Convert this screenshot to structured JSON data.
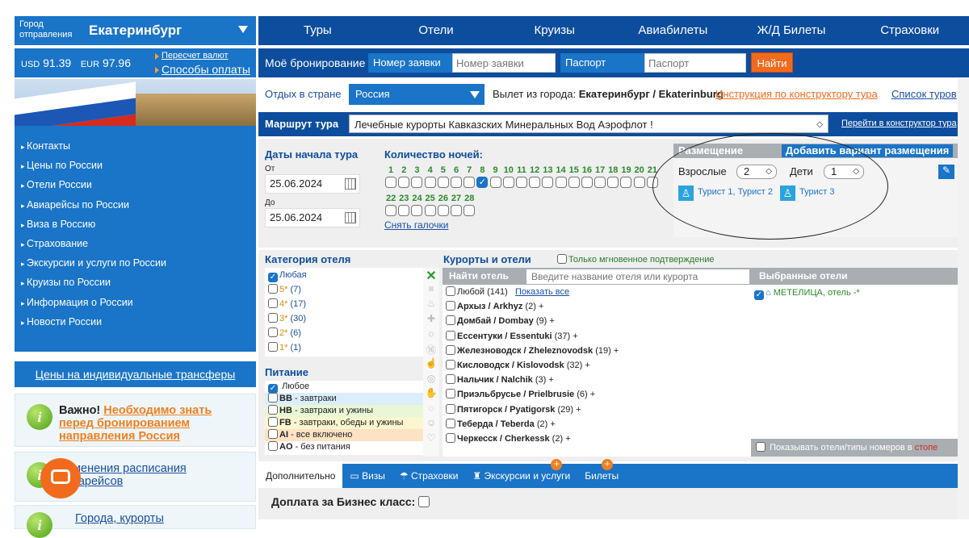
{
  "city": {
    "label_line1": "Город",
    "label_line2": "отправления",
    "name": "Екатеринбург"
  },
  "top_nav": [
    "Туры",
    "Отели",
    "Круизы",
    "Авиабилеты",
    "Ж/Д Билеты",
    "Страховки"
  ],
  "currency": {
    "usd_label": "USD",
    "usd_value": "91.39",
    "eur_label": "EUR",
    "eur_value": "97.96",
    "recalc_link": "Пересчет валют",
    "payment_link": "Способы оплаты"
  },
  "booking": {
    "title": "Моё бронирование",
    "order_label": "Номер заявки",
    "order_placeholder": "Номер заявки",
    "passport_label": "Паспорт",
    "passport_placeholder": "Паспорт",
    "find_button": "Найти"
  },
  "left_menu": [
    "Контакты",
    "Цены по России",
    "Отели России",
    "Авиарейсы по России",
    "Виза в Россию",
    "Страхование",
    "Экскурсии и услуги по России",
    "Круизы по России",
    "Информация о России",
    "Новости России"
  ],
  "transfer_link": "Цены на индивидуальные трансферы",
  "info1": {
    "icon": "i",
    "bold": "Важно!",
    "link": "Необходимо знать перед бронированием направления Россия"
  },
  "info2": {
    "icon": "i",
    "link": "Изменения расписания авиарейсов"
  },
  "info3": {
    "icon": "i",
    "link": "Города, курорты"
  },
  "country_row": {
    "label": "Отдых в стране",
    "country": "Россия",
    "departure_prefix": "Вылет из города:",
    "departure_city": "Екатеринбург / Ekaterinburg",
    "instruction_link": "Инструкция по конструктору тура",
    "tours_link": "Список туров"
  },
  "route": {
    "label": "Маршрут тура",
    "value": "Лечебные курорты Кавказских Минеральных Вод Аэрофлот   !",
    "link": "Перейти в конструктор тура"
  },
  "dates": {
    "title": "Даты начала тура",
    "from_label": "От",
    "from_value": "25.06.2024",
    "to_label": "До",
    "to_value": "25.06.2024"
  },
  "nights": {
    "title": "Количество ночей:",
    "row1": [
      "1",
      "2",
      "3",
      "4",
      "5",
      "6",
      "7",
      "8",
      "9",
      "10",
      "11",
      "12",
      "13",
      "14",
      "15",
      "16",
      "17",
      "18",
      "19",
      "20",
      "21"
    ],
    "row2": [
      "22",
      "23",
      "24",
      "25",
      "26",
      "27",
      "28"
    ],
    "checked": "8",
    "clear_link": "Снять галочки"
  },
  "placement": {
    "title": "Размещение",
    "add_button": "Добавить вариант размещения",
    "adults_label": "Взрослые",
    "adults_value": "2",
    "children_label": "Дети",
    "children_value": "1",
    "tourists_a": "Турист 1, Турист 2",
    "tourists_b": "Турист 3"
  },
  "hotel_category": {
    "title": "Категория отеля",
    "items": [
      {
        "label": "Любая",
        "star": "",
        "count": "",
        "checked": true
      },
      {
        "label": "",
        "star": "5*",
        "count": "(7)",
        "checked": false
      },
      {
        "label": "",
        "star": "4*",
        "count": "(17)",
        "checked": false
      },
      {
        "label": "",
        "star": "3*",
        "count": "(30)",
        "checked": false
      },
      {
        "label": "",
        "star": "2*",
        "count": "(6)",
        "checked": false
      },
      {
        "label": "",
        "star": "1*",
        "count": "(1)",
        "checked": false
      }
    ]
  },
  "meals": {
    "title": "Питание",
    "items": [
      {
        "code": "",
        "text": "Любое",
        "color": "#ffffff",
        "checked": true
      },
      {
        "code": "BB",
        "text": "- завтраки",
        "color": "#dbeefb",
        "checked": false
      },
      {
        "code": "HB",
        "text": "- завтраки и ужины",
        "color": "#e9f7d6",
        "checked": false
      },
      {
        "code": "FB",
        "text": "- завтраки, обеды и ужины",
        "color": "#fbf6cf",
        "checked": false
      },
      {
        "code": "AI",
        "text": "- все включено",
        "color": "#fde2c4",
        "checked": false
      },
      {
        "code": "AO",
        "text": "- без питания",
        "color": "#ffffff",
        "checked": false
      }
    ]
  },
  "resorts": {
    "title": "Курорты и отели",
    "instant_label": "Только мгновенное подтверждение",
    "find_label": "Найти отель",
    "search_placeholder": "Введите название отеля или курорта",
    "any_label": "Любой",
    "any_count": "(141)",
    "show_all": "Показать все",
    "items": [
      {
        "name": "Архыз / Arkhyz",
        "count": "(2)"
      },
      {
        "name": "Домбай / Dombay",
        "count": "(9)"
      },
      {
        "name": "Ессентуки / Essentuki",
        "count": "(37)"
      },
      {
        "name": "Железноводск / Zheleznovodsk",
        "count": "(19)"
      },
      {
        "name": "Кисловодск / Kislovodsk",
        "count": "(32)"
      },
      {
        "name": "Нальчик / Nalchik",
        "count": "(3)"
      },
      {
        "name": "Приэльбрусье / Prielbrusie",
        "count": "(6)"
      },
      {
        "name": "Пятигорск / Pyatigorsk",
        "count": "(29)"
      },
      {
        "name": "Теберда / Teberda",
        "count": "(2)"
      },
      {
        "name": "Черкесск / Cherkessk",
        "count": "(2)"
      }
    ]
  },
  "chosen": {
    "title": "Выбранные отели",
    "hotel": "МЕТЕЛИЦА, отель -*",
    "stop_label": "Показывать отели/типы номеров в",
    "stop_word": "стопе"
  },
  "tabs": [
    "Дополнительно",
    "Визы",
    "Страховки",
    "Экскурсии и услуги",
    "Билеты"
  ],
  "business_label": "Доплата за Бизнес класс:"
}
